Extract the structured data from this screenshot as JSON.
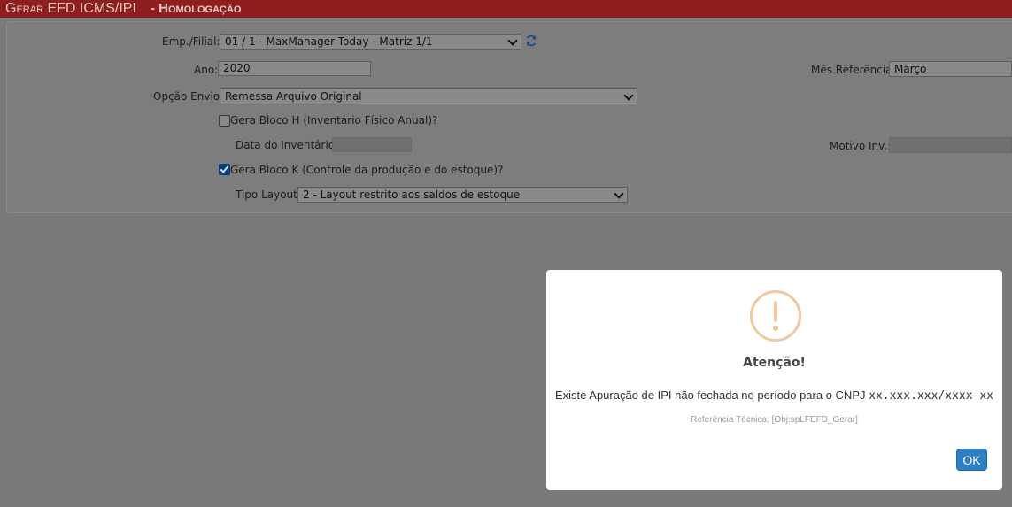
{
  "window": {
    "title": "Gerar EFD ICMS/IPI",
    "env": "- Homologação"
  },
  "form": {
    "emp_filial_label": "Emp./Filial:",
    "emp_filial_value": "01 / 1 - MaxManager Today - Matriz 1/1",
    "ano_label": "Ano:",
    "ano_value": "2020",
    "mes_label": "Mês Referência:",
    "mes_value": "Março",
    "opcao_envio_label": "Opção Envio:",
    "opcao_envio_value": "Remessa Arquivo Original",
    "bloco_h_label": "Gera Bloco H (Inventário Físico Anual)?",
    "bloco_h_checked": false,
    "data_inv_label": "Data do Inventário:",
    "data_inv_value": "",
    "motivo_inv_label": "Motivo Inv.:",
    "motivo_inv_value": "",
    "bloco_k_label": "Gera Bloco K (Controle da produção e do estoque)?",
    "bloco_k_checked": true,
    "tipo_layout_label": "Tipo Layout:",
    "tipo_layout_value": "2 - Layout restrito aos saldos de estoque"
  },
  "dialog": {
    "icon": "warning-icon",
    "title": "Atenção!",
    "message": "Existe Apuração de IPI não fechada no período para o CNPJ",
    "cnpj": "xx.xxx.xxx/xxxx-xx",
    "reference": "Referência Técnica: [Obj:spLFEFD_Gerar]",
    "ok_label": "OK"
  },
  "colors": {
    "titlebar": "#8f1e1e",
    "overlay_bg": "#7a7a7a",
    "ok_button": "#2f7fc5",
    "warning": "#f3c79f"
  }
}
